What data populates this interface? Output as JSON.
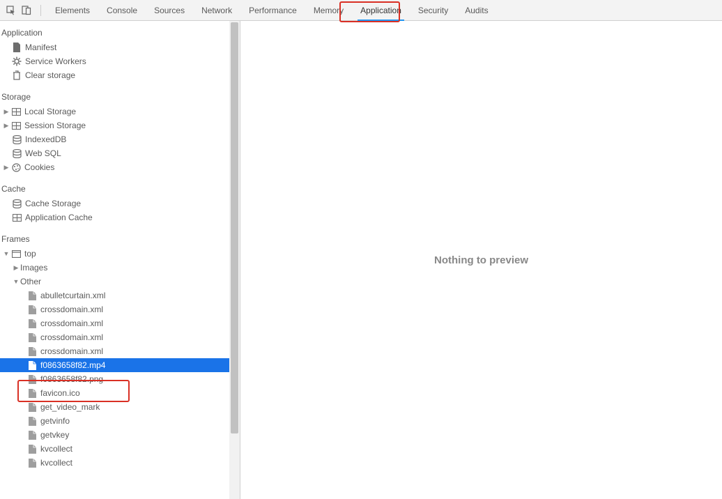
{
  "tabs": {
    "elements": "Elements",
    "console": "Console",
    "sources": "Sources",
    "network": "Network",
    "performance": "Performance",
    "memory": "Memory",
    "application": "Application",
    "security": "Security",
    "audits": "Audits"
  },
  "sidebar": {
    "sections": {
      "application": {
        "title": "Application",
        "items": {
          "manifest": "Manifest",
          "service_workers": "Service Workers",
          "clear_storage": "Clear storage"
        }
      },
      "storage": {
        "title": "Storage",
        "items": {
          "local_storage": "Local Storage",
          "session_storage": "Session Storage",
          "indexeddb": "IndexedDB",
          "websql": "Web SQL",
          "cookies": "Cookies"
        }
      },
      "cache": {
        "title": "Cache",
        "items": {
          "cache_storage": "Cache Storage",
          "app_cache": "Application Cache"
        }
      },
      "frames": {
        "title": "Frames",
        "top": "top",
        "images": "Images",
        "other": "Other",
        "files": {
          "f0": "abulletcurtain.xml",
          "f1": "crossdomain.xml",
          "f2": "crossdomain.xml",
          "f3": "crossdomain.xml",
          "f4": "crossdomain.xml",
          "f5": "f0863658f82.mp4",
          "f6": "f0863658f82.png",
          "f7": "favicon.ico",
          "f8": "get_video_mark",
          "f9": "getvinfo",
          "f10": "getvkey",
          "f11": "kvcollect",
          "f12": "kvcollect"
        }
      }
    }
  },
  "content": {
    "empty_message": "Nothing to preview"
  }
}
